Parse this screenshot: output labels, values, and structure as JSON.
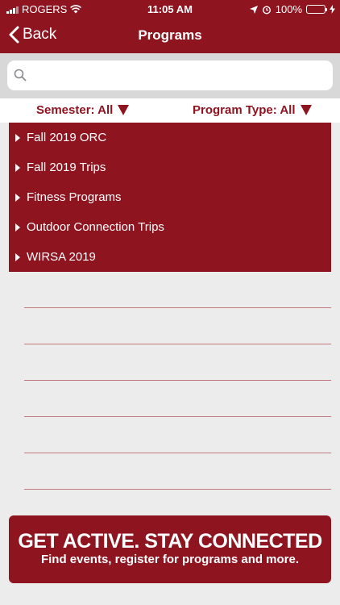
{
  "status": {
    "carrier": "ROGERS",
    "time": "11:05 AM",
    "battery": "100%"
  },
  "nav": {
    "back_label": "Back",
    "title": "Programs"
  },
  "search": {
    "placeholder": ""
  },
  "filters": {
    "semester": "Semester: All",
    "program_type": "Program Type: All"
  },
  "programs": [
    "Fall 2019 ORC",
    "Fall 2019 Trips",
    "Fitness Programs",
    "Outdoor Connection Trips",
    "WIRSA 2019"
  ],
  "banner": {
    "headline": "GET ACTIVE.  STAY CONNECTED",
    "subline": "Find events, register for programs and more."
  },
  "colors": {
    "brand": "#8e1420",
    "background": "#ececec"
  }
}
